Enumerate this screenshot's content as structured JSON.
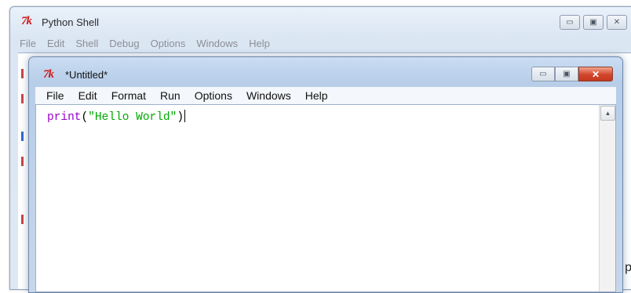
{
  "shell": {
    "logo": "7k",
    "title": "Python Shell",
    "menu": [
      "File",
      "Edit",
      "Shell",
      "Debug",
      "Options",
      "Windows",
      "Help"
    ],
    "controls": {
      "minimize": "▭",
      "maximize": "▣",
      "close": "✕"
    },
    "partial_text": "p"
  },
  "editor": {
    "logo": "7k",
    "title": "*Untitled*",
    "menu": [
      "File",
      "Edit",
      "Format",
      "Run",
      "Options",
      "Windows",
      "Help"
    ],
    "controls": {
      "minimize": "▭",
      "maximize": "▣",
      "close": "✕"
    },
    "code": {
      "func": "print",
      "open": "(",
      "string": "\"Hello World\"",
      "close": ")"
    },
    "colors": {
      "builtin": "#9900cc",
      "string": "#00aa00",
      "punctuation": "#000000"
    },
    "scroll_up_icon": "▲"
  }
}
